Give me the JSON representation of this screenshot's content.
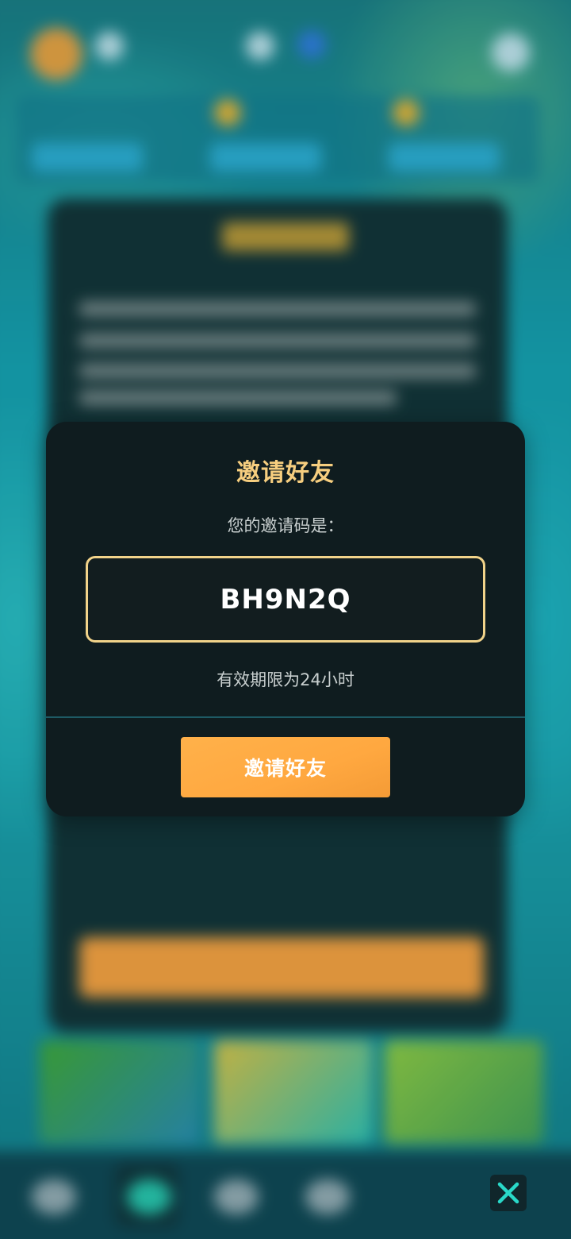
{
  "dialog": {
    "title": "邀请好友",
    "subtitle": "您的邀请码是：",
    "invite_code": "BH9N2Q",
    "validity_note": "有效期限为24小时",
    "invite_button_label": "邀请好友"
  },
  "colors": {
    "title": "#f6ce7f",
    "code_border": "#f1d38a",
    "button": "#ffa840",
    "dialog_bg": "#0f1c1f",
    "close_icon": "#29d8c8"
  },
  "icons": {
    "close": "close-icon"
  }
}
